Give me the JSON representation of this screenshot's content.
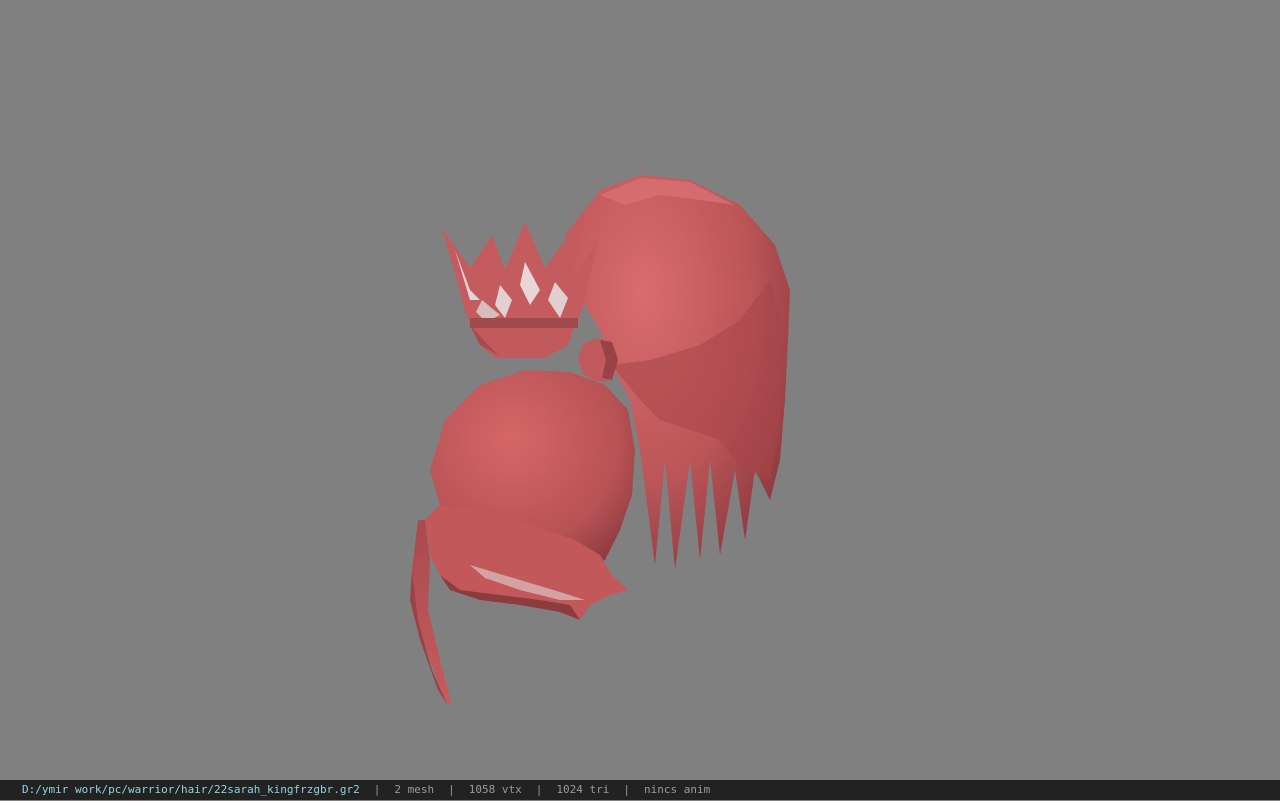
{
  "status_bar": {
    "file_path": "D:/ymir work/pc/warrior/hair/22sarah_kingfrzgbr.gr2",
    "separator": "|",
    "mesh_count": "2 mesh",
    "vertex_count": "1058 vtx",
    "triangle_count": "1024 tri",
    "anim_status": "nincs anim"
  },
  "colors": {
    "background": "#808080",
    "model_base": "#c45a5c",
    "model_light": "#d9696b",
    "model_shadow": "#8e3a3e",
    "status_bar_bg": "#222222",
    "path_text": "#8fd3e0"
  },
  "viewport": {
    "model_name": "22sarah_kingfrzgbr"
  }
}
